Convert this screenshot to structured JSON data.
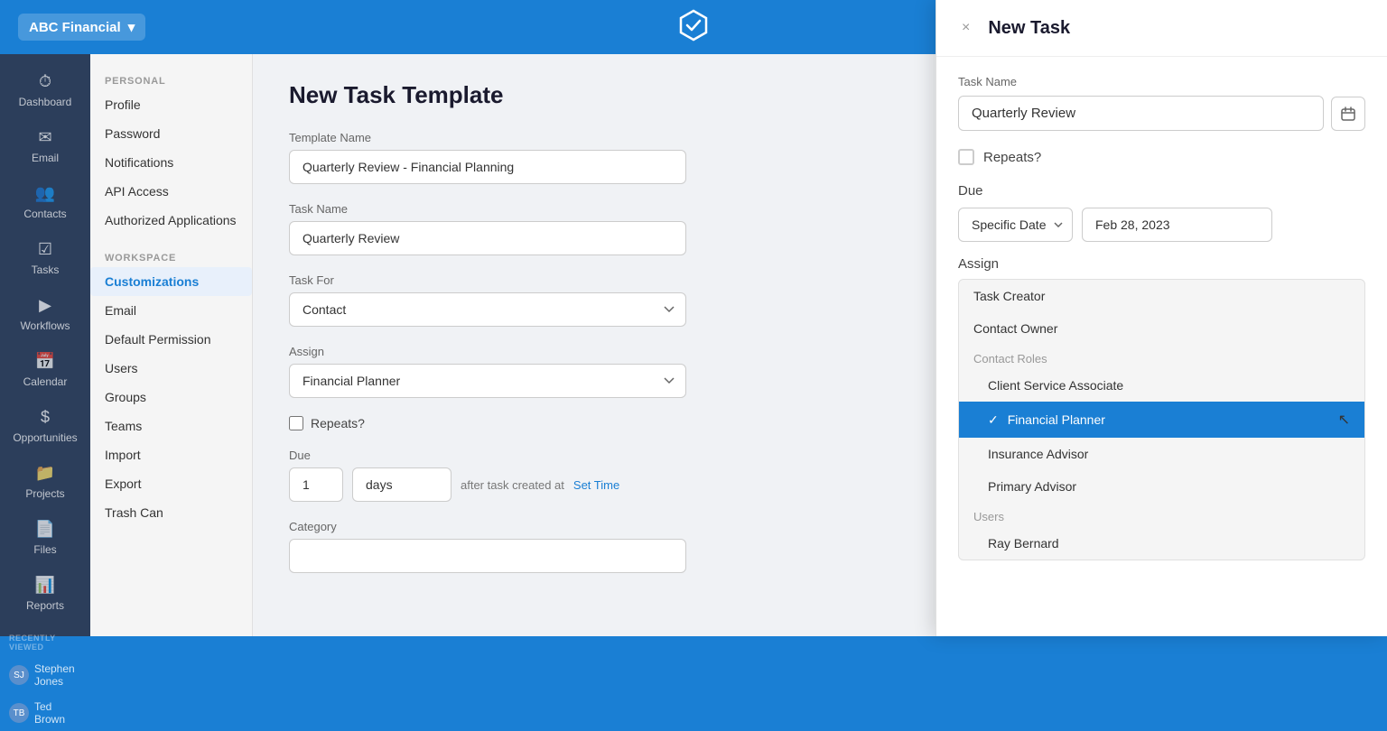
{
  "topbar": {
    "workspace_name": "ABC Financial",
    "chevron": "▾"
  },
  "sidebar": {
    "items": [
      {
        "label": "Dashboard",
        "icon": "⏱"
      },
      {
        "label": "Email",
        "icon": "✉"
      },
      {
        "label": "Contacts",
        "icon": "👥"
      },
      {
        "label": "Tasks",
        "icon": "☑"
      },
      {
        "label": "Workflows",
        "icon": "▶"
      },
      {
        "label": "Calendar",
        "icon": "📅"
      },
      {
        "label": "Opportunities",
        "icon": "$"
      },
      {
        "label": "Projects",
        "icon": "📁"
      },
      {
        "label": "Files",
        "icon": "📄"
      },
      {
        "label": "Reports",
        "icon": "📊"
      }
    ],
    "recently_viewed_label": "RECENTLY VIEWED",
    "recent_users": [
      {
        "name": "Stephen Jones",
        "initials": "SJ"
      },
      {
        "name": "Ted Brown",
        "initials": "TB"
      }
    ]
  },
  "settings_menu": {
    "personal_label": "PERSONAL",
    "personal_items": [
      "Profile",
      "Password",
      "Notifications",
      "API Access",
      "Authorized Applications"
    ],
    "workspace_label": "WORKSPACE",
    "workspace_items": [
      "Customizations",
      "Email",
      "Default Permission",
      "Users",
      "Groups",
      "Teams",
      "Import",
      "Export",
      "Trash Can"
    ],
    "active_item": "Customizations"
  },
  "main_form": {
    "title": "New Task Template",
    "template_name_label": "Template Name",
    "template_name_value": "Quarterly Review - Financial Planning",
    "task_name_label": "Task Name",
    "task_name_value": "Quarterly Review",
    "task_for_label": "Task For",
    "task_for_value": "Contact",
    "assign_label": "Assign",
    "assign_value": "Financial Planner",
    "repeats_label": "Repeats?",
    "due_label": "Due",
    "due_number": "1",
    "due_unit": "days",
    "due_suffix": "after task created at",
    "set_time_link": "Set Time",
    "category_label": "Category"
  },
  "modal": {
    "title": "New Task",
    "close_icon": "×",
    "task_name_label": "Task Name",
    "task_name_value": "Quarterly Review",
    "repeats_label": "Repeats?",
    "due_label": "Due",
    "due_type": "Specific Date",
    "due_date": "Feb 28, 2023",
    "assign_label": "Assign",
    "dropdown": {
      "items": [
        {
          "label": "Task Creator",
          "type": "option",
          "indented": false,
          "selected": false
        },
        {
          "label": "Contact Owner",
          "type": "option",
          "indented": false,
          "selected": false
        },
        {
          "label": "Contact Roles",
          "type": "group",
          "indented": false,
          "selected": false
        },
        {
          "label": "Client Service Associate",
          "type": "option",
          "indented": true,
          "selected": false
        },
        {
          "label": "Financial Planner",
          "type": "option",
          "indented": true,
          "selected": true
        },
        {
          "label": "Insurance Advisor",
          "type": "option",
          "indented": true,
          "selected": false
        },
        {
          "label": "Primary Advisor",
          "type": "option",
          "indented": true,
          "selected": false
        },
        {
          "label": "Users",
          "type": "group",
          "indented": false,
          "selected": false
        },
        {
          "label": "Ray Bernard",
          "type": "option",
          "indented": true,
          "selected": false
        }
      ]
    }
  }
}
